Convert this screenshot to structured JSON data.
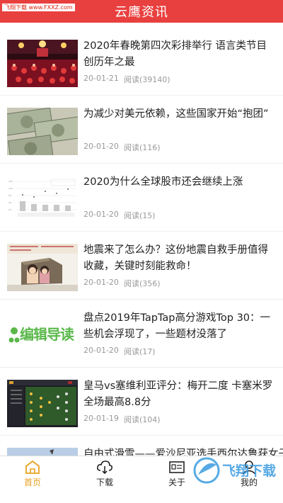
{
  "header": {
    "title": "云鹰资讯",
    "watermark": "飞翔下载 www.FXXZ.com"
  },
  "articles": [
    {
      "title": "2020年春晚第四次彩排举行 语言类节目创历年之最",
      "date": "20-01-21",
      "reads": "阅读(39140)",
      "thumb": "concert-stage-image"
    },
    {
      "title": "为减少对美元依赖，这些国家开始“抱团”",
      "date": "20-01-20",
      "reads": "阅读(116)",
      "thumb": "dollar-bills-image"
    },
    {
      "title": "2020为什么全球股市还会继续上涨",
      "date": "20-01-20",
      "reads": "阅读(15)",
      "thumb": "bar-chart-image"
    },
    {
      "title": "地震来了怎么办？这份地震自救手册值得收藏，关键时刻能救命！",
      "date": "20-01-20",
      "reads": "阅读(356)",
      "thumb": "earthquake-cartoon-image"
    },
    {
      "title": "盘点2019年TapTap高分游戏Top 30：一些机会浮现了，一些题材没落了",
      "date": "20-01-20",
      "reads": "阅读(17)",
      "thumb": "editor-guide-image",
      "thumb_text": "编辑导读"
    },
    {
      "title": "皇马vs塞维利亚评分：梅开二度 卡塞米罗全场最高8.8分",
      "date": "20-01-19",
      "reads": "阅读(104)",
      "thumb": "football-lineup-image"
    },
    {
      "title": "自由式滑雪——爱沙尼亚选手西尔达鲁获女子",
      "date": "",
      "reads": "",
      "thumb": "ski-image"
    }
  ],
  "tabs": [
    {
      "label": "首页",
      "icon": "home-icon",
      "active": true
    },
    {
      "label": "下载",
      "icon": "cloud-download-icon",
      "active": false
    },
    {
      "label": "关于",
      "icon": "id-card-icon",
      "active": false
    },
    {
      "label": "我的",
      "icon": "user-icon",
      "active": false
    }
  ],
  "corner_logo": "飞翔下载",
  "colors": {
    "header": "#e8403f",
    "active_tab": "#e8a020",
    "guide_green": "#5ab84a"
  }
}
